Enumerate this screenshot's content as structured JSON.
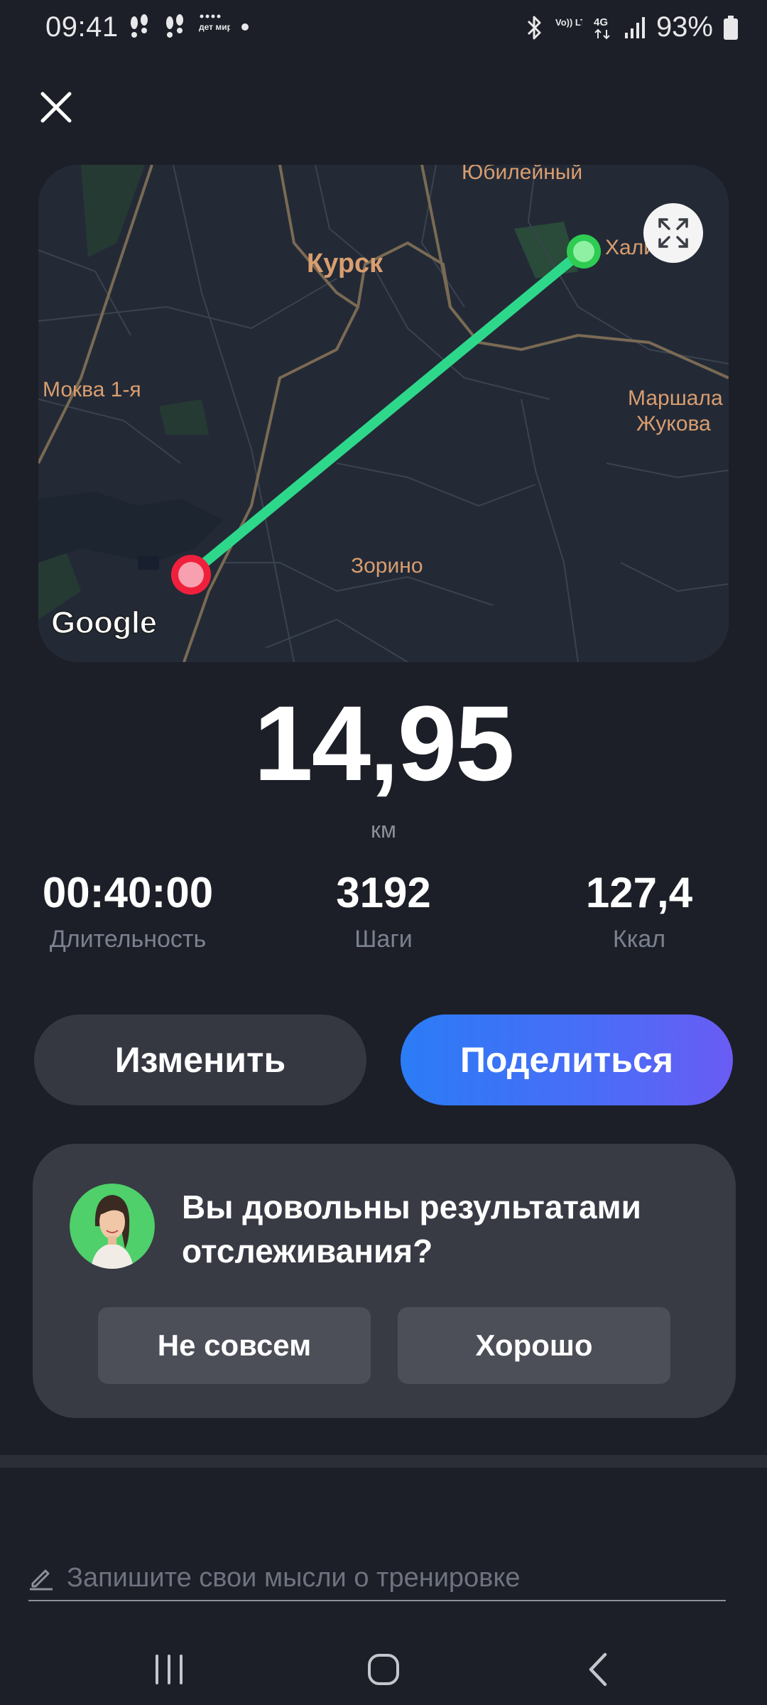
{
  "status_bar": {
    "time": "09:41",
    "battery_percent": "93%",
    "left_icons": [
      "steps-icon",
      "steps-icon",
      "detmir-app-icon",
      "dot-icon"
    ],
    "right_icons": [
      "bluetooth-icon",
      "volte-icon",
      "4g-icon",
      "signal-icon",
      "battery-icon"
    ],
    "volte_label": "Vo)) LTE",
    "network_label": "4G",
    "app_badge_label": "дет мир"
  },
  "map": {
    "labels": {
      "kursk": "Курск",
      "yubileyny": "Юбилейный",
      "khalino": "Хали",
      "mokva": "Моква 1-я",
      "marshala_1": "Маршала",
      "marshala_2": "Жукова",
      "zorino": "Зорино"
    },
    "attribution": "Google",
    "route_color": "#2ed88a",
    "start_color": "#2ecc52",
    "end_color": "#f0203c"
  },
  "workout": {
    "distance": "14,95",
    "distance_unit": "км",
    "stats": [
      {
        "value": "00:40:00",
        "label": "Длительность"
      },
      {
        "value": "3192",
        "label": "Шаги"
      },
      {
        "value": "127,4",
        "label": "Ккал"
      }
    ]
  },
  "actions": {
    "edit_label": "Изменить",
    "share_label": "Поделиться"
  },
  "feedback": {
    "question": "Вы довольны результатами отслеживания?",
    "option_no": "Не совсем",
    "option_yes": "Хорошо"
  },
  "notes": {
    "placeholder": "Запишите свои мысли о тренировке",
    "value": ""
  },
  "colors": {
    "background": "#1c1f27",
    "accent_gradient_start": "#2b7cf6",
    "accent_gradient_end": "#6a5cf4"
  }
}
